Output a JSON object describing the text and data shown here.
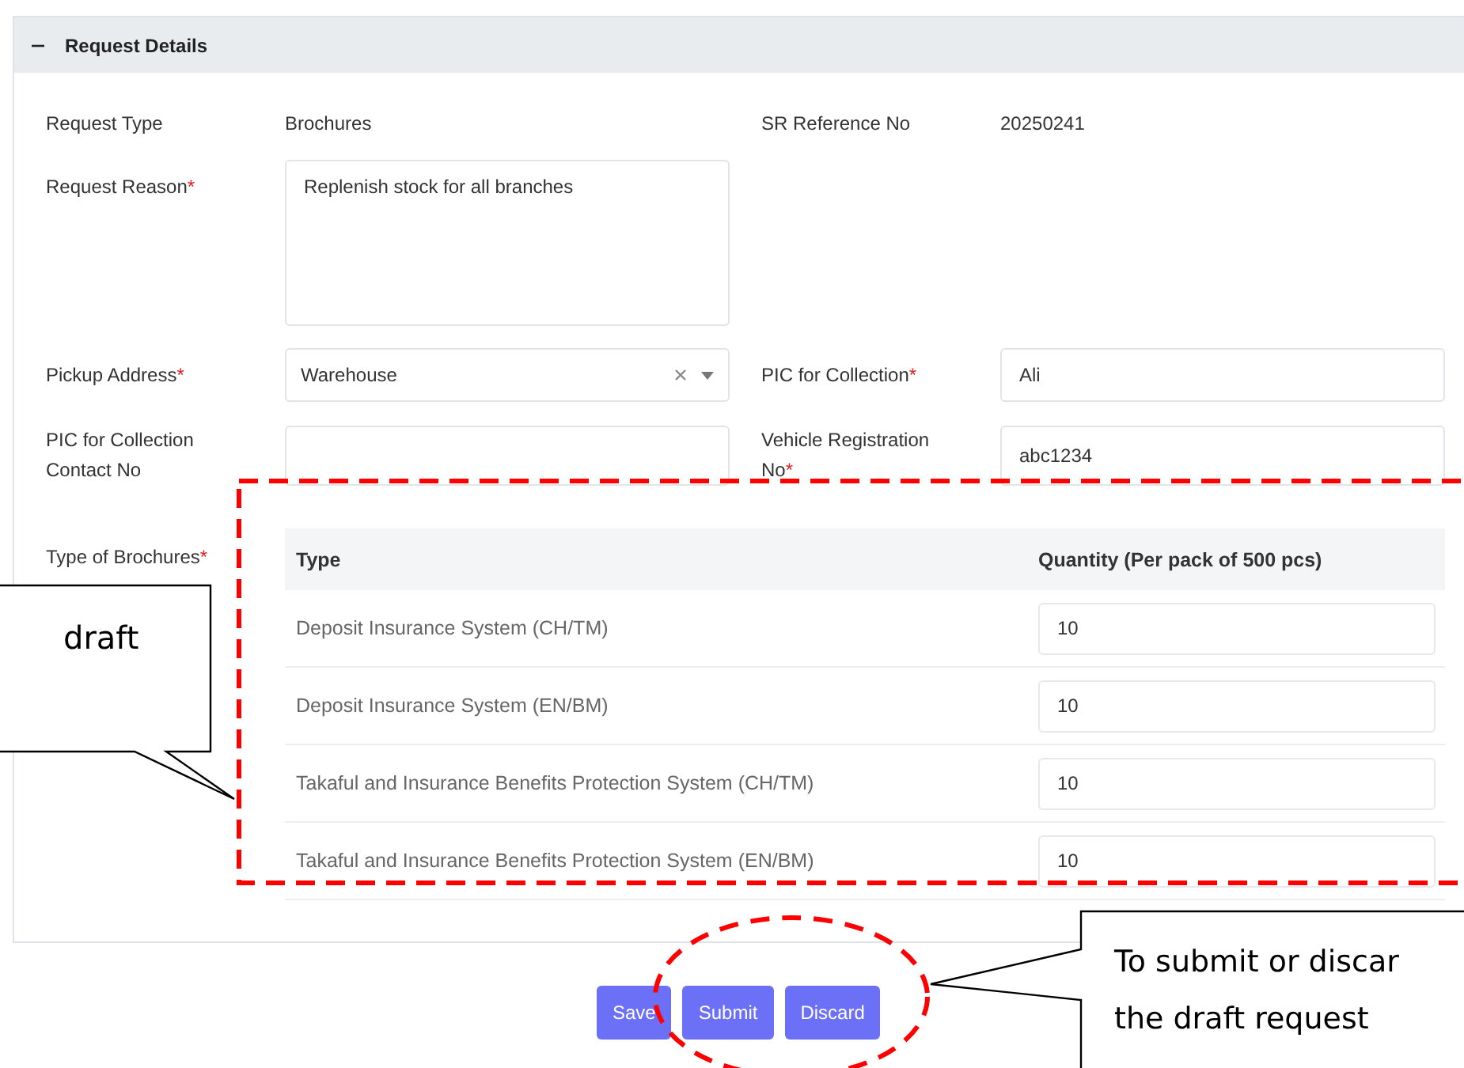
{
  "section": {
    "title": "Request Details",
    "expanded": true
  },
  "rows": [
    [
      {
        "label": "Request Type",
        "kind": "text",
        "value": "Brochures"
      },
      {
        "label": "SR Reference No",
        "kind": "text",
        "value": "20250241"
      }
    ],
    [
      {
        "label": "Request Reason",
        "required_mark": "*",
        "kind": "textarea",
        "value": "Replenish stock for all branches"
      }
    ],
    [
      {
        "label": "Pickup Address",
        "required_mark": "*",
        "kind": "select",
        "value": "Warehouse"
      },
      {
        "label": "PIC for Collection",
        "required_mark": "*",
        "kind": "input",
        "value": "Ali"
      }
    ],
    [
      {
        "label": "PIC for Collection Contact No",
        "kind": "input"
      },
      {
        "label": "Vehicle Registration No",
        "required_mark": "*",
        "kind": "input",
        "value": "abc1234"
      }
    ]
  ],
  "brochures": {
    "label": "Type of Brochures",
    "required_mark": "*",
    "columns": [
      "Type",
      "Quantity (Per pack of 500 pcs)"
    ],
    "rows": [
      {
        "type": "Deposit Insurance System (CH/TM)",
        "quantity": "10"
      },
      {
        "type": "Deposit Insurance System (EN/BM)",
        "quantity": "10"
      },
      {
        "type": "Takaful and Insurance Benefits Protection System (CH/TM)",
        "quantity": "10"
      },
      {
        "type": "Takaful and Insurance Benefits Protection System (EN/BM)",
        "quantity": "10"
      }
    ]
  },
  "buttons": [
    "Save",
    "Submit",
    "Discard"
  ],
  "callouts": [
    {
      "kind": "left",
      "lines": [
        "draft"
      ]
    },
    {
      "kind": "right",
      "lines": [
        "To submit or discar",
        "the draft request"
      ]
    }
  ]
}
